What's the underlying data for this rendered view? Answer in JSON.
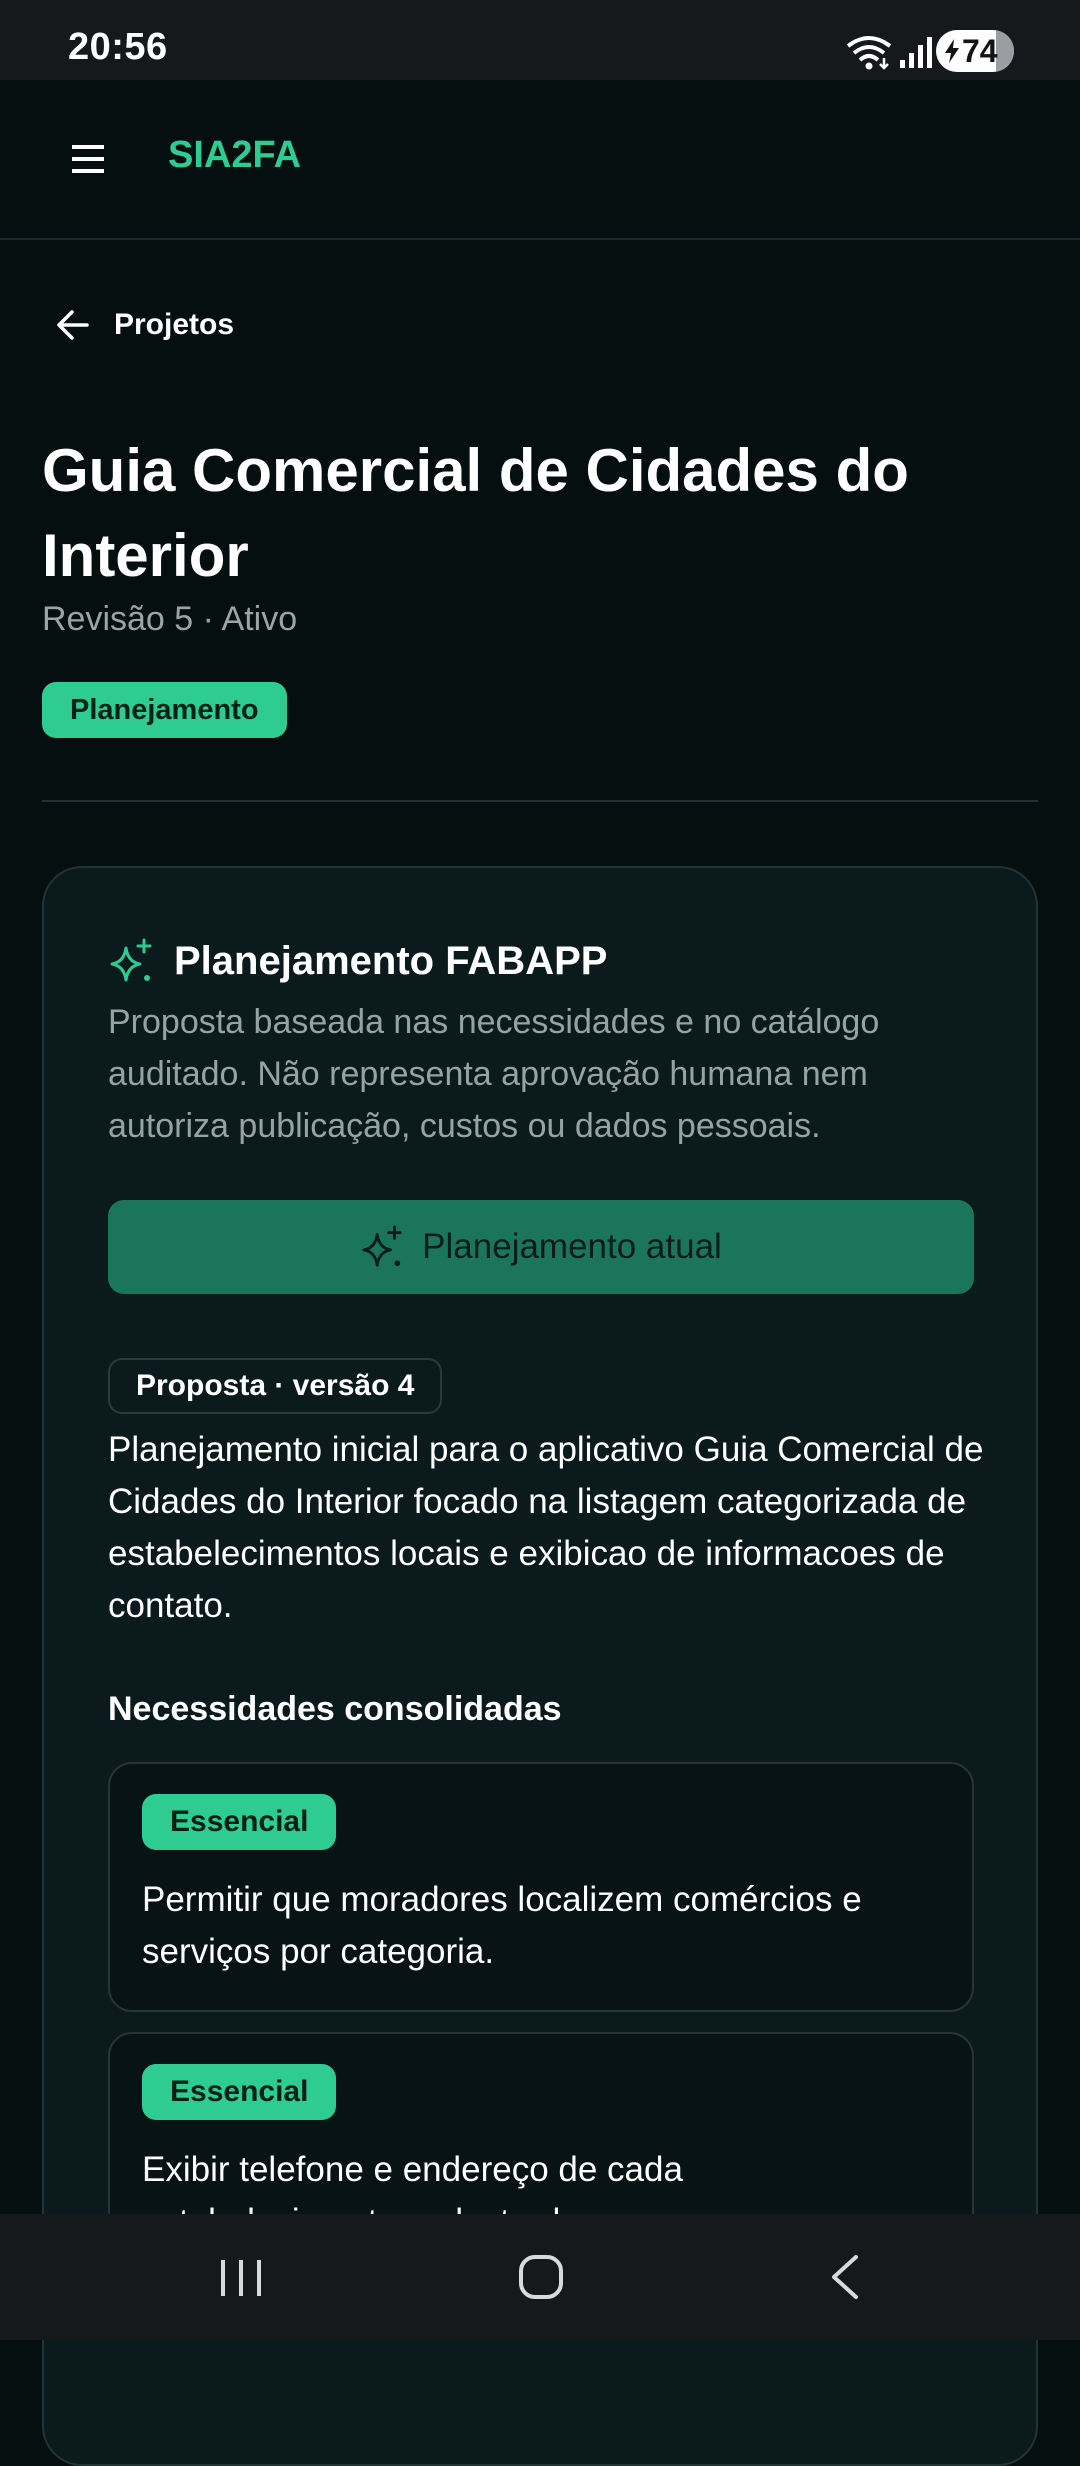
{
  "status_bar": {
    "time": "20:56",
    "battery": "74"
  },
  "app_bar": {
    "title": "SIA2FA",
    "accent_color": "#2fcc92"
  },
  "back_link": {
    "label": "Projetos"
  },
  "project": {
    "title": "Guia Comercial de Cidades do Interior",
    "subtitle": "Revisão 5 · Ativo",
    "stage_badge": "Planejamento"
  },
  "plan_card": {
    "title": "Planejamento FABAPP",
    "description": "Proposta baseada nas necessidades e no catálogo auditado. Não representa aprovação humana nem autoriza publicação, custos ou dados pessoais.",
    "current_plan_button": "Planejamento atual",
    "version_chip": "Proposta · versão 4",
    "proposal_text": "Planejamento inicial para o aplicativo Guia Comercial de Cidades do Interior focado na listagem categorizada de estabelecimentos locais e exibicao de informacoes de contato.",
    "needs_heading": "Necessidades consolidadas",
    "needs": [
      {
        "badge": "Essencial",
        "text": "Permitir que moradores localizem comércios e serviços por categoria."
      },
      {
        "badge": "Essencial",
        "text": "Exibir telefone e endereço de cada estabelecimento cadastrado."
      }
    ]
  }
}
